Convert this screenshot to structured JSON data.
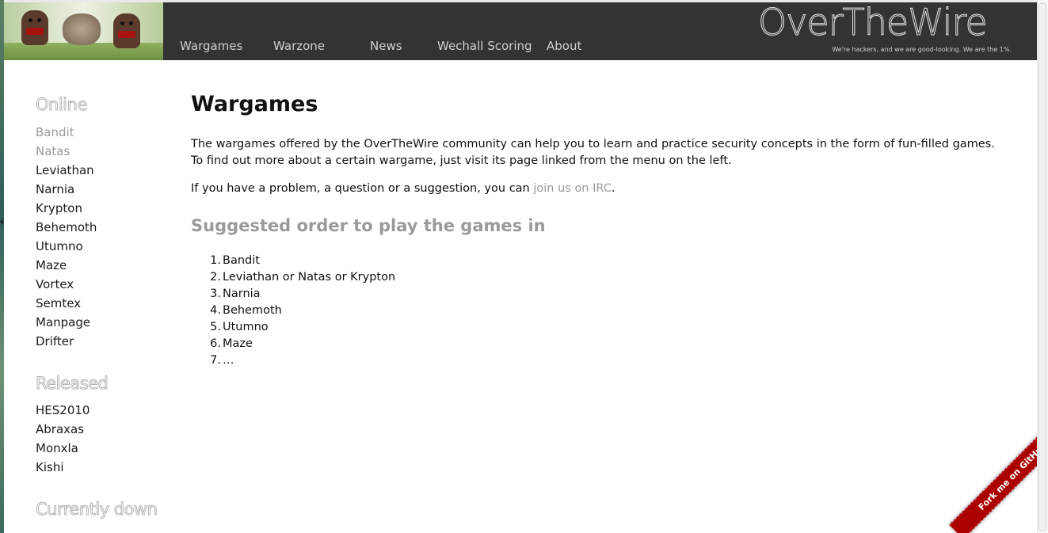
{
  "header": {
    "nav": [
      {
        "label": "Wargames"
      },
      {
        "label": "Warzone"
      },
      {
        "label": "News"
      },
      {
        "label": "Wechall Scoring"
      },
      {
        "label": "About"
      }
    ],
    "logo_text": "OverTheWire",
    "tagline": "We're hackers, and we are good-looking. We are the 1%."
  },
  "sidebar": {
    "online": {
      "heading": "Online",
      "items": [
        {
          "label": "Bandit"
        },
        {
          "label": "Natas"
        },
        {
          "label": "Leviathan"
        },
        {
          "label": "Narnia"
        },
        {
          "label": "Krypton"
        },
        {
          "label": "Behemoth"
        },
        {
          "label": "Utumno"
        },
        {
          "label": "Maze"
        },
        {
          "label": "Vortex"
        },
        {
          "label": "Semtex"
        },
        {
          "label": "Manpage"
        },
        {
          "label": "Drifter"
        }
      ]
    },
    "released": {
      "heading": "Released",
      "items": [
        {
          "label": "HES2010"
        },
        {
          "label": "Abraxas"
        },
        {
          "label": "Monxla"
        },
        {
          "label": "Kishi"
        }
      ]
    },
    "down": {
      "heading": "Currently down"
    }
  },
  "main": {
    "title": "Wargames",
    "intro_line1": "The wargames offered by the OverTheWire community can help you to learn and practice security concepts in the form of fun-filled games.",
    "intro_line2": "To find out more about a certain wargame, just visit its page linked from the menu on the left.",
    "help_prefix": "If you have a problem, a question or a suggestion, you can ",
    "help_link": "join us on IRC",
    "help_suffix": ".",
    "suggested_title": "Suggested order to play the games in",
    "order": [
      {
        "num": "1.",
        "text": "Bandit"
      },
      {
        "num": "2.",
        "text": "Leviathan or Natas or Krypton"
      },
      {
        "num": "3.",
        "text": "Narnia"
      },
      {
        "num": "4.",
        "text": "Behemoth"
      },
      {
        "num": "5.",
        "text": "Utumno"
      },
      {
        "num": "6.",
        "text": "Maze"
      },
      {
        "num": "7.",
        "text": "…"
      }
    ]
  },
  "ribbon": {
    "label": "Fork me on GitHub"
  },
  "colors": {
    "header_bg": "#333333",
    "ribbon": "#aa0000",
    "muted_text": "#9a9a9a"
  }
}
